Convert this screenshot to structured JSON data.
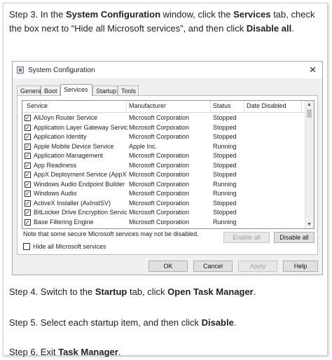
{
  "steps": {
    "s3": {
      "prefix": "Step 3. In the ",
      "b1": "System Configuration",
      "mid1": " window, click the ",
      "b2": "Services",
      "mid2": " tab, check the box next to “Hide all Microsoft services”, and then click ",
      "b3": "Disable all",
      "suffix": "."
    },
    "s4": {
      "prefix": "Step 4. Switch to the ",
      "b1": "Startup",
      "mid1": " tab, click ",
      "b2": "Open Task Manager",
      "suffix": "."
    },
    "s5": {
      "prefix": "Step 5. Select each startup item, and then click ",
      "b1": "Disable",
      "suffix": "."
    },
    "s6": {
      "prefix": "Step 6. Exit ",
      "b1": "Task Manager",
      "suffix": "."
    }
  },
  "dialog": {
    "title": "System Configuration",
    "close_glyph": "✕",
    "tabs": [
      "General",
      "Boot",
      "Services",
      "Startup",
      "Tools"
    ],
    "active_tab": "Services",
    "columns": [
      "Service",
      "Manufacturer",
      "Status",
      "Date Disabled"
    ],
    "rows": [
      {
        "service": "AllJoyn Router Service",
        "manufacturer": "Microsoft Corporation",
        "status": "Stopped",
        "checked": true
      },
      {
        "service": "Application Layer Gateway Service",
        "manufacturer": "Microsoft Corporation",
        "status": "Stopped",
        "checked": true
      },
      {
        "service": "Application Identity",
        "manufacturer": "Microsoft Corporation",
        "status": "Stopped",
        "checked": true
      },
      {
        "service": "Apple Mobile Device Service",
        "manufacturer": "Apple Inc.",
        "status": "Running",
        "checked": true
      },
      {
        "service": "Application Management",
        "manufacturer": "Microsoft Corporation",
        "status": "Stopped",
        "checked": true
      },
      {
        "service": "App Readiness",
        "manufacturer": "Microsoft Corporation",
        "status": "Stopped",
        "checked": true
      },
      {
        "service": "AppX Deployment Service (AppX...",
        "manufacturer": "Microsoft Corporation",
        "status": "Stopped",
        "checked": true
      },
      {
        "service": "Windows Audio Endpoint Builder",
        "manufacturer": "Microsoft Corporation",
        "status": "Running",
        "checked": true
      },
      {
        "service": "Windows Audio",
        "manufacturer": "Microsoft Corporation",
        "status": "Running",
        "checked": true
      },
      {
        "service": "ActiveX Installer (AxInstSV)",
        "manufacturer": "Microsoft Corporation",
        "status": "Stopped",
        "checked": true
      },
      {
        "service": "BitLocker Drive Encryption Service",
        "manufacturer": "Microsoft Corporation",
        "status": "Stopped",
        "checked": true
      },
      {
        "service": "Base Filtering Engine",
        "manufacturer": "Microsoft Corporation",
        "status": "Running",
        "checked": true
      }
    ],
    "note": "Note that some secure Microsoft services may not be disabled.",
    "enable_all": "Enable all",
    "disable_all": "Disable all",
    "hide_ms_label": "Hide all Microsoft services",
    "hide_ms_checked": false,
    "ok": "OK",
    "cancel": "Cancel",
    "apply": "Apply",
    "help": "Help",
    "check_glyph": "✓",
    "scroll_up_glyph": "▲",
    "scroll_down_glyph": "▼"
  }
}
